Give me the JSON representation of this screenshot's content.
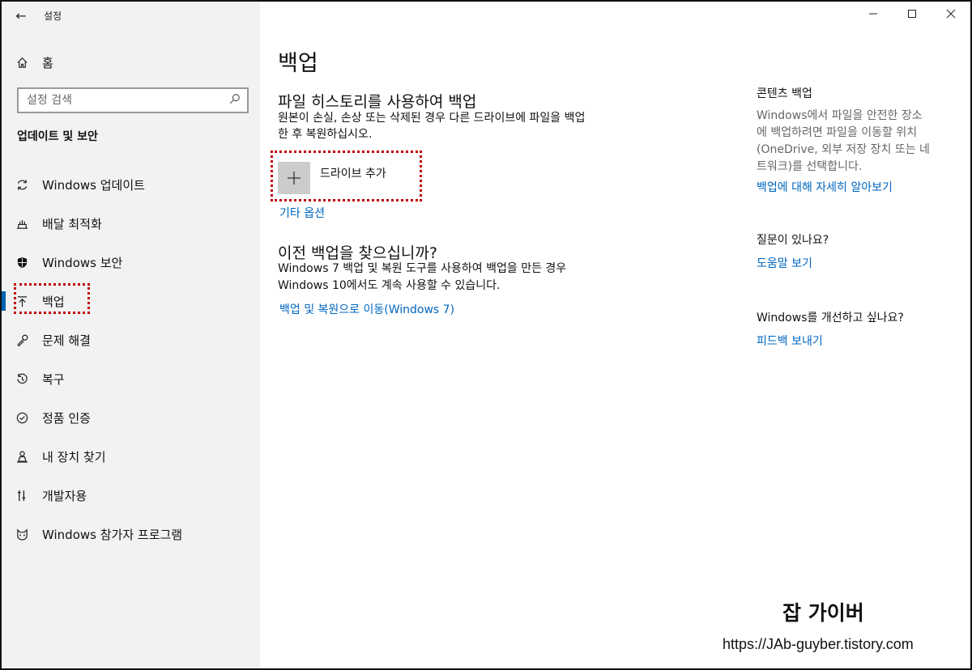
{
  "window": {
    "title": "설정",
    "minimize_icon": "minimize-icon",
    "maximize_icon": "maximize-icon",
    "close_icon": "close-icon"
  },
  "sidebar": {
    "home_label": "홈",
    "search_placeholder": "설정 검색",
    "section_title": "업데이트 및 보안",
    "items": [
      {
        "label": "Windows 업데이트",
        "icon": "refresh-icon"
      },
      {
        "label": "배달 최적화",
        "icon": "delivery-icon"
      },
      {
        "label": "Windows 보안",
        "icon": "shield-icon"
      },
      {
        "label": "백업",
        "icon": "backup-arrow-icon",
        "active": true
      },
      {
        "label": "문제 해결",
        "icon": "wrench-icon"
      },
      {
        "label": "복구",
        "icon": "recovery-icon"
      },
      {
        "label": "정품 인증",
        "icon": "check-circle-icon"
      },
      {
        "label": "내 장치 찾기",
        "icon": "person-locate-icon"
      },
      {
        "label": "개발자용",
        "icon": "developer-icon"
      },
      {
        "label": "Windows 참가자 프로그램",
        "icon": "insider-cat-icon"
      }
    ]
  },
  "main": {
    "title": "백업",
    "file_history": {
      "heading": "파일 히스토리를 사용하여 백업",
      "description_line1": "원본이 손실, 손상 또는 삭제된 경우 다른 드라이브에 파일을 백업",
      "description_line2": "한 후 복원하십시오.",
      "add_drive_label": "드라이브 추가",
      "more_options_link": "기타 옵션"
    },
    "older_backup": {
      "heading": "이전 백업을 찾으십니까?",
      "description_line1": "Windows 7 백업 및 복원 도구를 사용하여 백업을 만든 경우",
      "description_line2": "Windows 10에서도 계속 사용할 수 있습니다.",
      "link": "백업 및 복원으로 이동(Windows 7)"
    }
  },
  "right_panel": {
    "content_backup": {
      "heading": "콘텐츠 백업",
      "text_lines": [
        "Windows에서 파일을 안전한 장소",
        "에 백업하려면 파일을 이동할 위치",
        "(OneDrive, 외부 저장 장치 또는 네",
        "트워크)를 선택합니다."
      ],
      "link": "백업에 대해 자세히 알아보기"
    },
    "questions": {
      "heading": "질문이 있나요?",
      "link": "도움말 보기"
    },
    "improve": {
      "heading": "Windows를 개선하고 싶나요?",
      "link": "피드백 보내기"
    }
  },
  "watermark": {
    "title": "잡 가이버",
    "url": "https://JAb-guyber.tistory.com"
  },
  "colors": {
    "accent": "#0067c0",
    "sidebar_bg": "#f2f2f2",
    "highlight_box": "#c00000"
  }
}
